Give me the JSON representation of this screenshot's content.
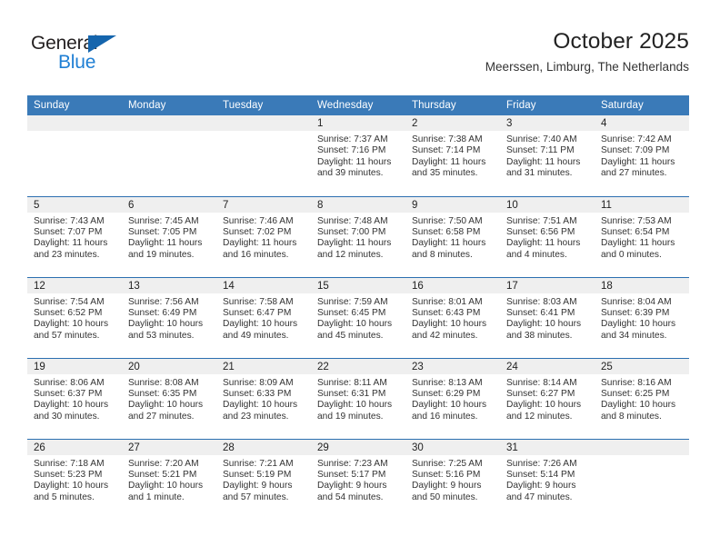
{
  "brand": {
    "name_part1": "General",
    "name_part2": "Blue",
    "logo_icon": "triangle-logo-icon",
    "accent_color": "#1f7fd4",
    "dark_color": "#231f20"
  },
  "header": {
    "title": "October 2025",
    "subtitle": "Meerssen, Limburg, The Netherlands"
  },
  "theme": {
    "header_row_bg": "#3a7ab8",
    "row_divider": "#2b6fb0",
    "daynum_band_bg": "#efefef",
    "text_color": "#333333"
  },
  "calendar": {
    "weekday_headers": [
      "Sunday",
      "Monday",
      "Tuesday",
      "Wednesday",
      "Thursday",
      "Friday",
      "Saturday"
    ],
    "weeks": [
      [
        {
          "day": "",
          "empty": true
        },
        {
          "day": "",
          "empty": true
        },
        {
          "day": "",
          "empty": true
        },
        {
          "day": "1",
          "sunrise": "Sunrise: 7:37 AM",
          "sunset": "Sunset: 7:16 PM",
          "daylight_line1": "Daylight: 11 hours",
          "daylight_line2": "and 39 minutes."
        },
        {
          "day": "2",
          "sunrise": "Sunrise: 7:38 AM",
          "sunset": "Sunset: 7:14 PM",
          "daylight_line1": "Daylight: 11 hours",
          "daylight_line2": "and 35 minutes."
        },
        {
          "day": "3",
          "sunrise": "Sunrise: 7:40 AM",
          "sunset": "Sunset: 7:11 PM",
          "daylight_line1": "Daylight: 11 hours",
          "daylight_line2": "and 31 minutes."
        },
        {
          "day": "4",
          "sunrise": "Sunrise: 7:42 AM",
          "sunset": "Sunset: 7:09 PM",
          "daylight_line1": "Daylight: 11 hours",
          "daylight_line2": "and 27 minutes."
        }
      ],
      [
        {
          "day": "5",
          "sunrise": "Sunrise: 7:43 AM",
          "sunset": "Sunset: 7:07 PM",
          "daylight_line1": "Daylight: 11 hours",
          "daylight_line2": "and 23 minutes."
        },
        {
          "day": "6",
          "sunrise": "Sunrise: 7:45 AM",
          "sunset": "Sunset: 7:05 PM",
          "daylight_line1": "Daylight: 11 hours",
          "daylight_line2": "and 19 minutes."
        },
        {
          "day": "7",
          "sunrise": "Sunrise: 7:46 AM",
          "sunset": "Sunset: 7:02 PM",
          "daylight_line1": "Daylight: 11 hours",
          "daylight_line2": "and 16 minutes."
        },
        {
          "day": "8",
          "sunrise": "Sunrise: 7:48 AM",
          "sunset": "Sunset: 7:00 PM",
          "daylight_line1": "Daylight: 11 hours",
          "daylight_line2": "and 12 minutes."
        },
        {
          "day": "9",
          "sunrise": "Sunrise: 7:50 AM",
          "sunset": "Sunset: 6:58 PM",
          "daylight_line1": "Daylight: 11 hours",
          "daylight_line2": "and 8 minutes."
        },
        {
          "day": "10",
          "sunrise": "Sunrise: 7:51 AM",
          "sunset": "Sunset: 6:56 PM",
          "daylight_line1": "Daylight: 11 hours",
          "daylight_line2": "and 4 minutes."
        },
        {
          "day": "11",
          "sunrise": "Sunrise: 7:53 AM",
          "sunset": "Sunset: 6:54 PM",
          "daylight_line1": "Daylight: 11 hours",
          "daylight_line2": "and 0 minutes."
        }
      ],
      [
        {
          "day": "12",
          "sunrise": "Sunrise: 7:54 AM",
          "sunset": "Sunset: 6:52 PM",
          "daylight_line1": "Daylight: 10 hours",
          "daylight_line2": "and 57 minutes."
        },
        {
          "day": "13",
          "sunrise": "Sunrise: 7:56 AM",
          "sunset": "Sunset: 6:49 PM",
          "daylight_line1": "Daylight: 10 hours",
          "daylight_line2": "and 53 minutes."
        },
        {
          "day": "14",
          "sunrise": "Sunrise: 7:58 AM",
          "sunset": "Sunset: 6:47 PM",
          "daylight_line1": "Daylight: 10 hours",
          "daylight_line2": "and 49 minutes."
        },
        {
          "day": "15",
          "sunrise": "Sunrise: 7:59 AM",
          "sunset": "Sunset: 6:45 PM",
          "daylight_line1": "Daylight: 10 hours",
          "daylight_line2": "and 45 minutes."
        },
        {
          "day": "16",
          "sunrise": "Sunrise: 8:01 AM",
          "sunset": "Sunset: 6:43 PM",
          "daylight_line1": "Daylight: 10 hours",
          "daylight_line2": "and 42 minutes."
        },
        {
          "day": "17",
          "sunrise": "Sunrise: 8:03 AM",
          "sunset": "Sunset: 6:41 PM",
          "daylight_line1": "Daylight: 10 hours",
          "daylight_line2": "and 38 minutes."
        },
        {
          "day": "18",
          "sunrise": "Sunrise: 8:04 AM",
          "sunset": "Sunset: 6:39 PM",
          "daylight_line1": "Daylight: 10 hours",
          "daylight_line2": "and 34 minutes."
        }
      ],
      [
        {
          "day": "19",
          "sunrise": "Sunrise: 8:06 AM",
          "sunset": "Sunset: 6:37 PM",
          "daylight_line1": "Daylight: 10 hours",
          "daylight_line2": "and 30 minutes."
        },
        {
          "day": "20",
          "sunrise": "Sunrise: 8:08 AM",
          "sunset": "Sunset: 6:35 PM",
          "daylight_line1": "Daylight: 10 hours",
          "daylight_line2": "and 27 minutes."
        },
        {
          "day": "21",
          "sunrise": "Sunrise: 8:09 AM",
          "sunset": "Sunset: 6:33 PM",
          "daylight_line1": "Daylight: 10 hours",
          "daylight_line2": "and 23 minutes."
        },
        {
          "day": "22",
          "sunrise": "Sunrise: 8:11 AM",
          "sunset": "Sunset: 6:31 PM",
          "daylight_line1": "Daylight: 10 hours",
          "daylight_line2": "and 19 minutes."
        },
        {
          "day": "23",
          "sunrise": "Sunrise: 8:13 AM",
          "sunset": "Sunset: 6:29 PM",
          "daylight_line1": "Daylight: 10 hours",
          "daylight_line2": "and 16 minutes."
        },
        {
          "day": "24",
          "sunrise": "Sunrise: 8:14 AM",
          "sunset": "Sunset: 6:27 PM",
          "daylight_line1": "Daylight: 10 hours",
          "daylight_line2": "and 12 minutes."
        },
        {
          "day": "25",
          "sunrise": "Sunrise: 8:16 AM",
          "sunset": "Sunset: 6:25 PM",
          "daylight_line1": "Daylight: 10 hours",
          "daylight_line2": "and 8 minutes."
        }
      ],
      [
        {
          "day": "26",
          "sunrise": "Sunrise: 7:18 AM",
          "sunset": "Sunset: 5:23 PM",
          "daylight_line1": "Daylight: 10 hours",
          "daylight_line2": "and 5 minutes."
        },
        {
          "day": "27",
          "sunrise": "Sunrise: 7:20 AM",
          "sunset": "Sunset: 5:21 PM",
          "daylight_line1": "Daylight: 10 hours",
          "daylight_line2": "and 1 minute."
        },
        {
          "day": "28",
          "sunrise": "Sunrise: 7:21 AM",
          "sunset": "Sunset: 5:19 PM",
          "daylight_line1": "Daylight: 9 hours",
          "daylight_line2": "and 57 minutes."
        },
        {
          "day": "29",
          "sunrise": "Sunrise: 7:23 AM",
          "sunset": "Sunset: 5:17 PM",
          "daylight_line1": "Daylight: 9 hours",
          "daylight_line2": "and 54 minutes."
        },
        {
          "day": "30",
          "sunrise": "Sunrise: 7:25 AM",
          "sunset": "Sunset: 5:16 PM",
          "daylight_line1": "Daylight: 9 hours",
          "daylight_line2": "and 50 minutes."
        },
        {
          "day": "31",
          "sunrise": "Sunrise: 7:26 AM",
          "sunset": "Sunset: 5:14 PM",
          "daylight_line1": "Daylight: 9 hours",
          "daylight_line2": "and 47 minutes."
        },
        {
          "day": "",
          "empty": true
        }
      ]
    ]
  }
}
